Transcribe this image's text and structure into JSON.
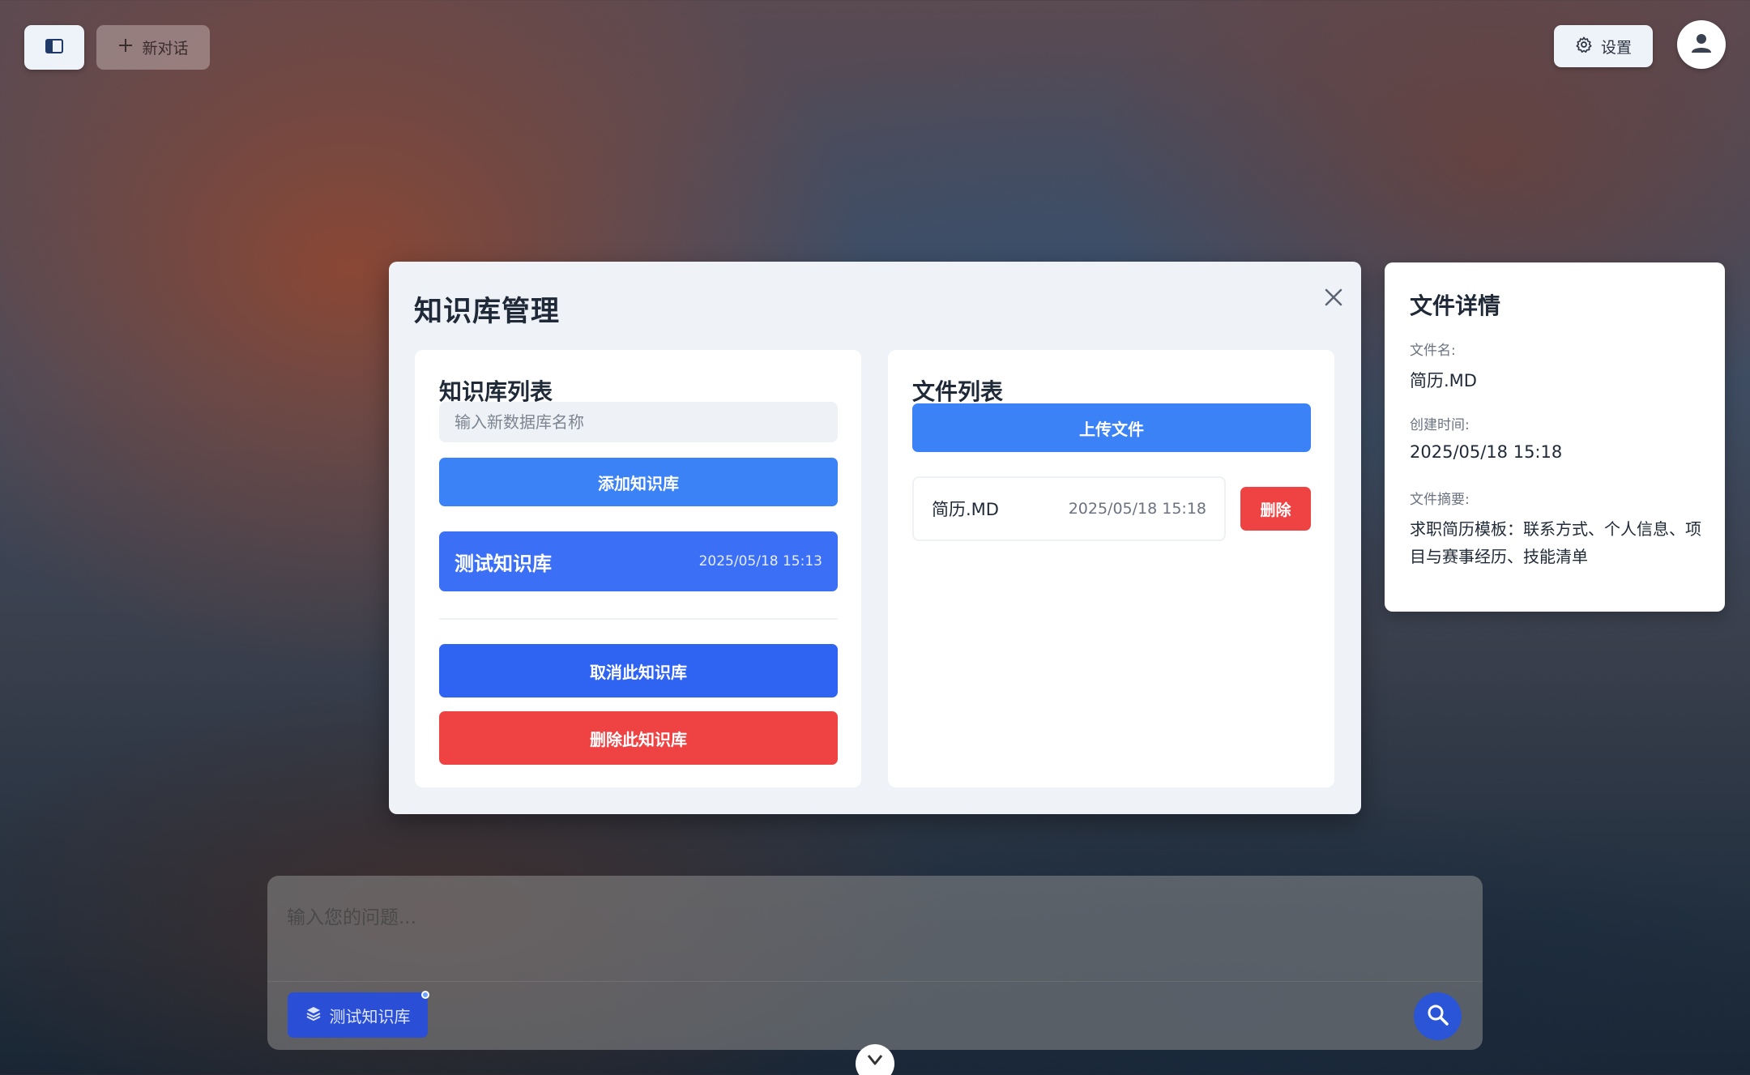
{
  "topbar": {
    "new_chat_label": "新对话",
    "settings_label": "设置"
  },
  "modal": {
    "title": "知识库管理",
    "kb_panel": {
      "title": "知识库列表",
      "input_placeholder": "输入新数据库名称",
      "add_label": "添加知识库",
      "items": [
        {
          "name": "测试知识库",
          "date": "2025/05/18 15:13"
        }
      ],
      "cancel_label": "取消此知识库",
      "delete_label": "删除此知识库"
    },
    "file_panel": {
      "title": "文件列表",
      "upload_label": "上传文件",
      "files": [
        {
          "name": "简历.MD",
          "date": "2025/05/18 15:18",
          "delete_label": "删除"
        }
      ]
    }
  },
  "detail": {
    "title": "文件详情",
    "filename_label": "文件名:",
    "filename": "简历.MD",
    "created_label": "创建时间:",
    "created": "2025/05/18 15:18",
    "summary_label": "文件摘要:",
    "summary": "求职简历模板：联系方式、个人信息、项目与赛事经历、技能清单"
  },
  "chat": {
    "placeholder": "输入您的问题...",
    "kb_chip_label": "测试知识库"
  },
  "colors": {
    "primary": "#3b82f6",
    "primary_dark": "#2f63f2",
    "danger": "#ef4343",
    "modal_bg": "#eff3f8"
  }
}
